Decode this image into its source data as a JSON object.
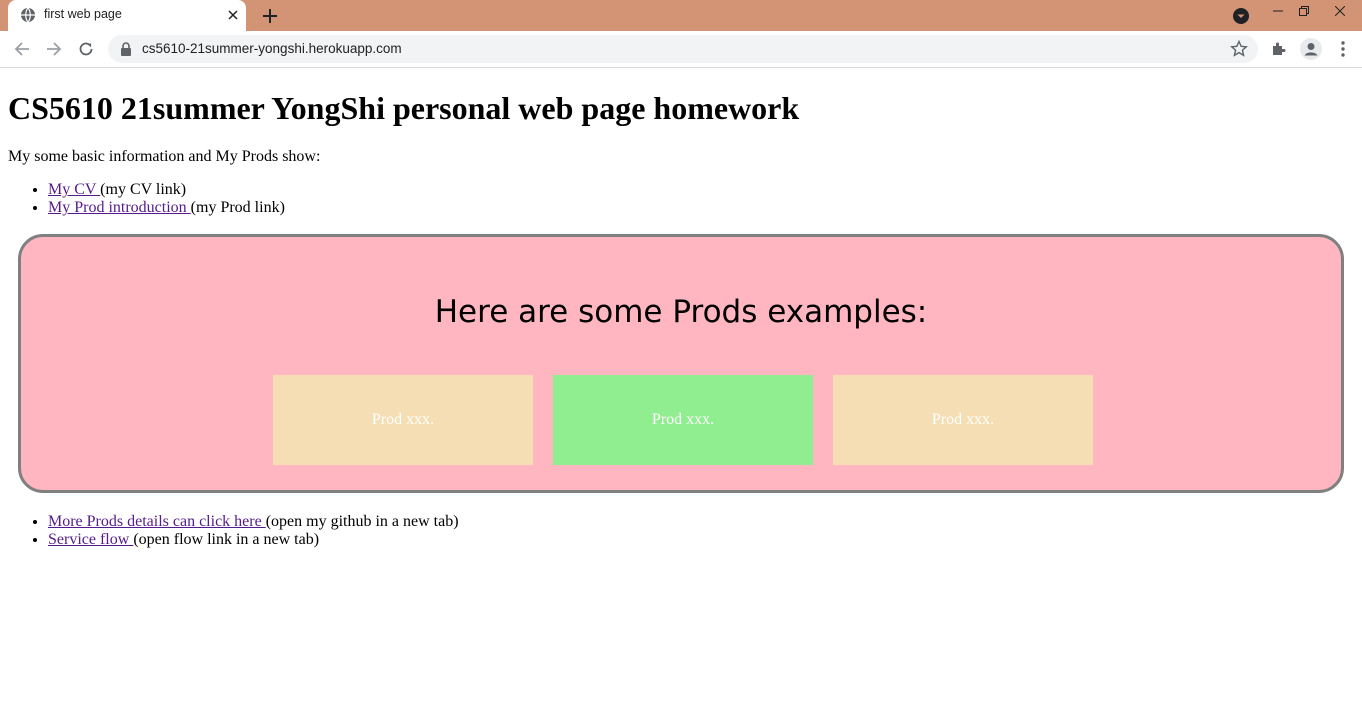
{
  "browser": {
    "tab_title": "first web page",
    "url": "cs5610-21summer-yongshi.herokuapp.com",
    "titlebar_color": "#d29474"
  },
  "page": {
    "heading": "CS5610 21summer YongShi personal web page homework",
    "intro": "My some basic information and My Prods show:",
    "top_links": [
      {
        "link": "My CV ",
        "note": "(my CV link)"
      },
      {
        "link": "My Prod introduction ",
        "note": "(my Prod link)"
      }
    ],
    "prods": {
      "heading": "Here are some Prods examples:",
      "cards": [
        {
          "label": "Prod xxx.",
          "color": "#f5deb3"
        },
        {
          "label": "Prod xxx.",
          "color": "#90ee90"
        },
        {
          "label": "Prod xxx.",
          "color": "#f5deb3"
        }
      ]
    },
    "bottom_links": [
      {
        "link": "More Prods details can click here ",
        "note": "(open my github in a new tab)"
      },
      {
        "link": "Service flow ",
        "note": "(open flow link in a new tab)"
      }
    ]
  }
}
